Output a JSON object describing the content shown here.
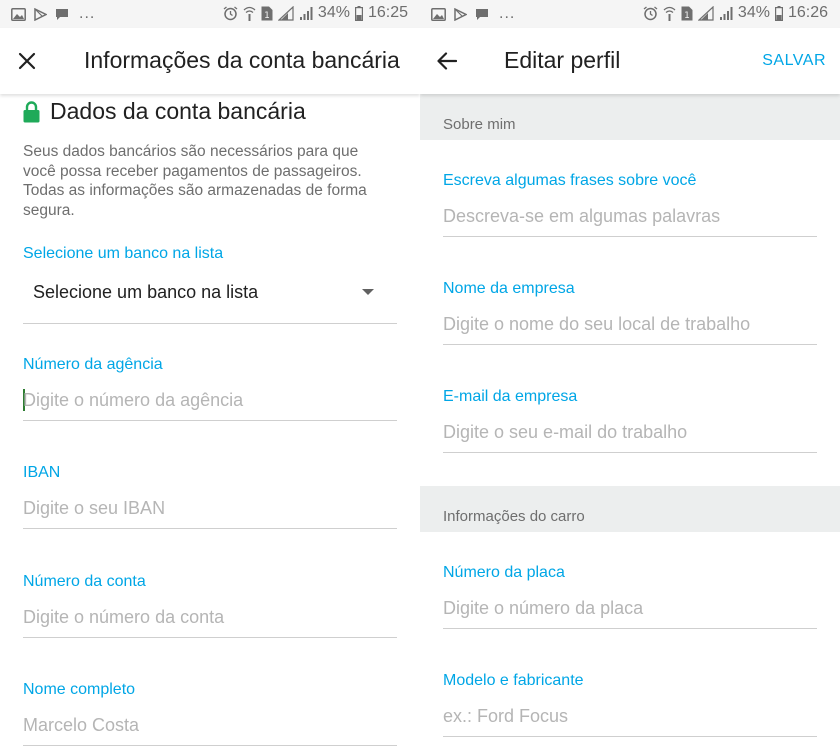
{
  "left_screen": {
    "status_bar": {
      "battery": "34%",
      "time": "16:25",
      "more": "..."
    },
    "app_bar": {
      "title": "Informações da conta bancária",
      "nav_icon": "close-icon"
    },
    "heading": {
      "icon": "lock-icon",
      "text": "Dados da conta bancária",
      "icon_color": "#1faa59"
    },
    "description": "Seus dados bancários são necessários para que você possa receber pagamentos de passageiros. Todas as informações são armazenadas de forma segura.",
    "bank_select": {
      "label": "Selecione um banco na lista",
      "value": "Selecione um banco na lista"
    },
    "fields": [
      {
        "label": "Número da agência",
        "placeholder": "Digite o número da agência",
        "value": ""
      },
      {
        "label": "IBAN",
        "placeholder": "Digite o seu IBAN",
        "value": ""
      },
      {
        "label": "Número da conta",
        "placeholder": "Digite o número da conta",
        "value": ""
      },
      {
        "label": "Nome completo",
        "placeholder": "Marcelo Costa",
        "value": ""
      }
    ]
  },
  "right_screen": {
    "status_bar": {
      "battery": "34%",
      "time": "16:26",
      "more": "..."
    },
    "app_bar": {
      "title": "Editar perfil",
      "nav_icon": "back-arrow-icon",
      "action": "SALVAR"
    },
    "sections": [
      {
        "title": "Sobre mim"
      },
      {
        "title": "Informações do carro"
      }
    ],
    "fields": [
      {
        "label": "Escreva algumas frases sobre você",
        "placeholder": "Descreva-se em algumas palavras",
        "value": ""
      },
      {
        "label": "Nome da empresa",
        "placeholder": "Digite o nome do seu local de trabalho",
        "value": ""
      },
      {
        "label": "E-mail da empresa",
        "placeholder": "Digite o seu e-mail do trabalho",
        "value": ""
      },
      {
        "label": "Número da placa",
        "placeholder": "Digite o número da placa",
        "value": ""
      },
      {
        "label": "Modelo e fabricante",
        "placeholder": "ex.: Ford Focus",
        "value": ""
      }
    ]
  },
  "colors": {
    "accent": "#00a6e6",
    "section_bg": "#eceeee",
    "status_bar_bg": "#f5f5f5",
    "lock_green": "#1faa59"
  }
}
